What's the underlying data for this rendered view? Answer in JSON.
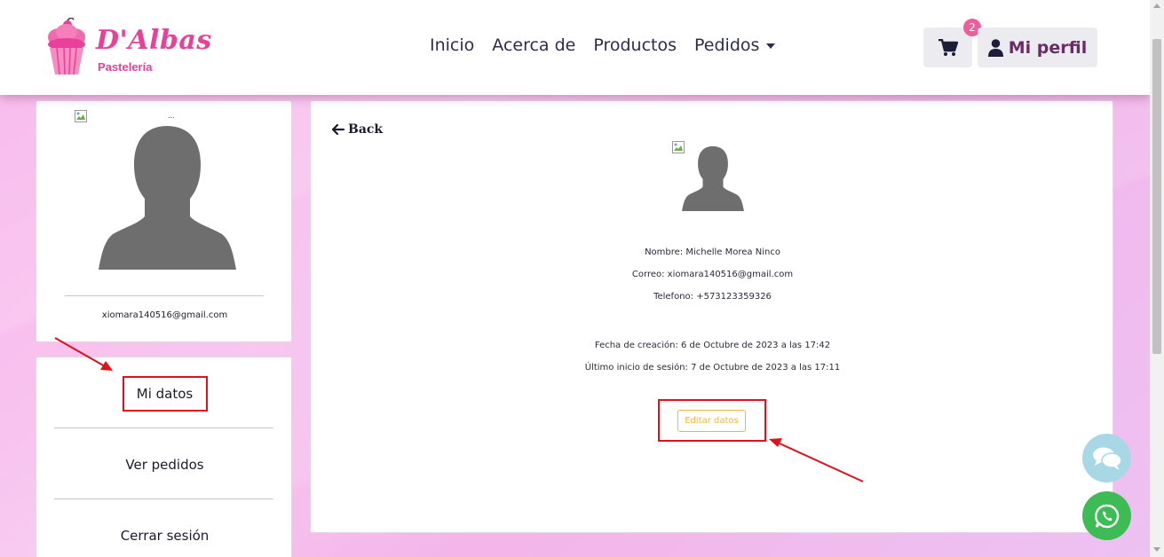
{
  "brand": {
    "name": "D'Albas",
    "subtitle": "Pastelería",
    "color": "#e9409a"
  },
  "nav": {
    "links": [
      "Inicio",
      "Acerca de",
      "Productos",
      "Pedidos"
    ],
    "cart_count": "2",
    "profile_label": "Mi perfil"
  },
  "sidebar": {
    "avatar_alt": "...",
    "email": "xiomara140516@gmail.com",
    "menu": [
      "Mi datos",
      "Ver pedidos",
      "Cerrar sesión"
    ]
  },
  "main": {
    "back_label": "Back",
    "avatar_alt": "...",
    "nombre": "Nombre: Michelle Morea Ninco",
    "correo": "Correo: xiomara140516@gmail.com",
    "telefono": "Telefono: +573123359326",
    "fecha_creacion": "Fecha de creación: 6 de Octubre de 2023 a las 17:42",
    "ultimo_inicio": "Último inicio de sesión: 7 de Octubre de 2023 a las 17:11",
    "edit_button": "Editar datos"
  },
  "colors": {
    "accent": "#e9409a",
    "badge": "#ef5d9a",
    "edit_button": "#f0b931",
    "annotation": "#e0111b",
    "chat": "#a8d8e6",
    "whatsapp": "#3dbb55"
  },
  "icons": [
    "cupcake-logo-icon",
    "cart-icon",
    "user-icon",
    "arrow-left-icon",
    "broken-image-icon",
    "chat-icon",
    "whatsapp-icon"
  ]
}
